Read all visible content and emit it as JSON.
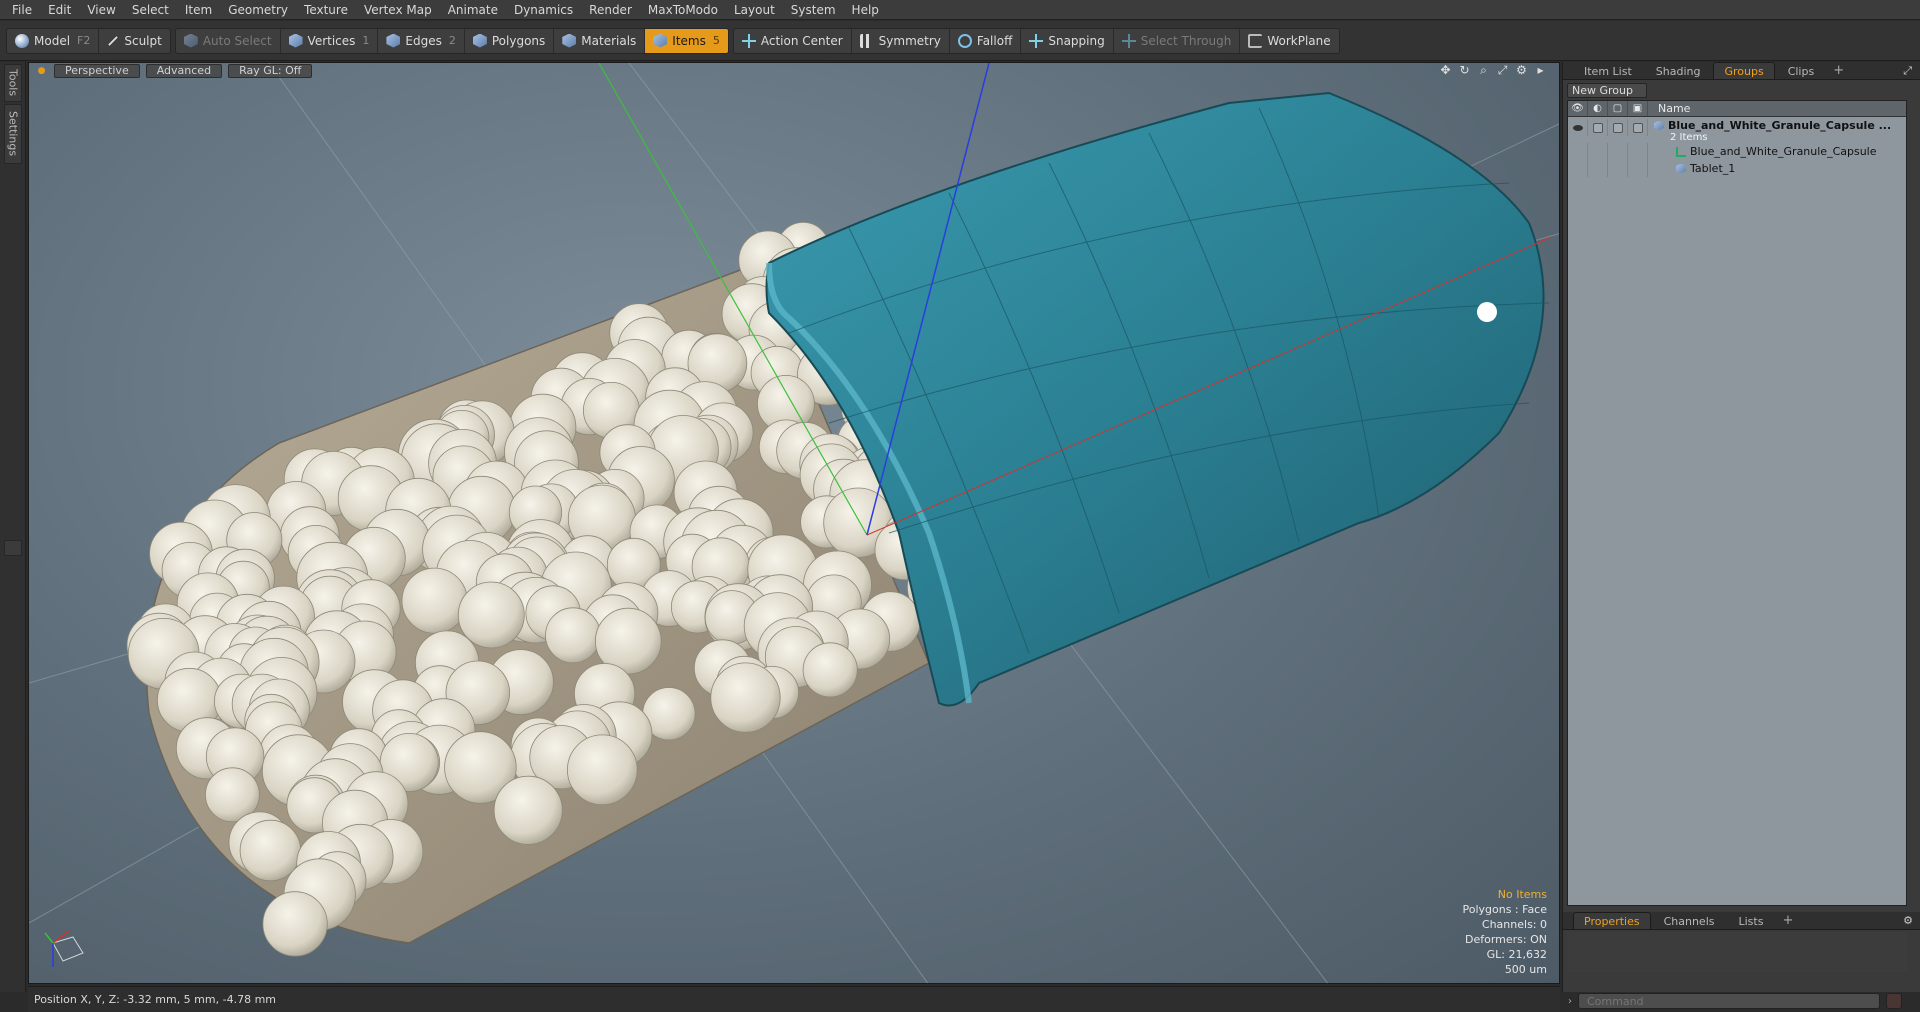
{
  "menu": [
    "File",
    "Edit",
    "View",
    "Select",
    "Item",
    "Geometry",
    "Texture",
    "Vertex Map",
    "Animate",
    "Dynamics",
    "Render",
    "MaxToModo",
    "Layout",
    "System",
    "Help"
  ],
  "toolbar": {
    "model": {
      "label": "Model",
      "key": "F2"
    },
    "sculpt": {
      "label": "Sculpt"
    },
    "auto_select": {
      "label": "Auto Select"
    },
    "vertices": {
      "label": "Vertices",
      "key": "1"
    },
    "edges": {
      "label": "Edges",
      "key": "2"
    },
    "polygons": {
      "label": "Polygons"
    },
    "materials": {
      "label": "Materials"
    },
    "items": {
      "label": "Items",
      "key": "5"
    },
    "action_center": {
      "label": "Action Center"
    },
    "symmetry": {
      "label": "Symmetry"
    },
    "falloff": {
      "label": "Falloff"
    },
    "snapping": {
      "label": "Snapping"
    },
    "select_through": {
      "label": "Select Through"
    },
    "workplane": {
      "label": "WorkPlane"
    }
  },
  "left_tabs": {
    "tools": "Tools",
    "settings": "Settings"
  },
  "viewport": {
    "view_mode": "Perspective",
    "shading": "Advanced",
    "raygl": "Ray GL: Off",
    "info": {
      "selection": "No Items",
      "polygons": "Polygons : Face",
      "channels": "Channels: 0",
      "deformers": "Deformers: ON",
      "gl": "GL: 21,632",
      "scale": "500 um"
    }
  },
  "right_panel": {
    "tabs": [
      "Item List",
      "Shading",
      "Groups",
      "Clips"
    ],
    "active_tab": "Groups",
    "new_group": "New Group",
    "column_name": "Name",
    "tree": {
      "group_name": "Blue_and_White_Granule_Capsule ...",
      "group_count": "2 Items",
      "children": [
        "Blue_and_White_Granule_Capsule",
        "Tablet_1"
      ]
    },
    "bottom_tabs": [
      "Properties",
      "Channels",
      "Lists"
    ],
    "bottom_active": "Properties"
  },
  "status": {
    "position": "Position X, Y, Z:  -3.32 mm, 5 mm, -4.78 mm"
  },
  "command": {
    "placeholder": "Command"
  },
  "colors": {
    "accent": "#e69a1a",
    "capsule_blue": "#2f8597",
    "granule": "#e8e4d6"
  }
}
